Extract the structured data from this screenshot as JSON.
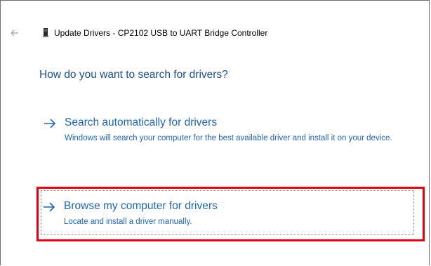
{
  "window": {
    "title": "Update Drivers - CP2102 USB to UART Bridge Controller",
    "back_icon": "arrow-left-icon",
    "device_icon": "usb-device-icon"
  },
  "heading": "How do you want to search for drivers?",
  "options": [
    {
      "icon": "arrow-right-icon",
      "title": "Search automatically for drivers",
      "description": "Windows will search your computer for the best available driver and install it on your device."
    },
    {
      "icon": "arrow-right-icon",
      "title": "Browse my computer for drivers",
      "description": "Locate and install a driver manually."
    }
  ],
  "colors": {
    "link_blue": "#1f65b8",
    "heading_blue": "#1c4f8f",
    "highlight_red": "#e0000f"
  }
}
